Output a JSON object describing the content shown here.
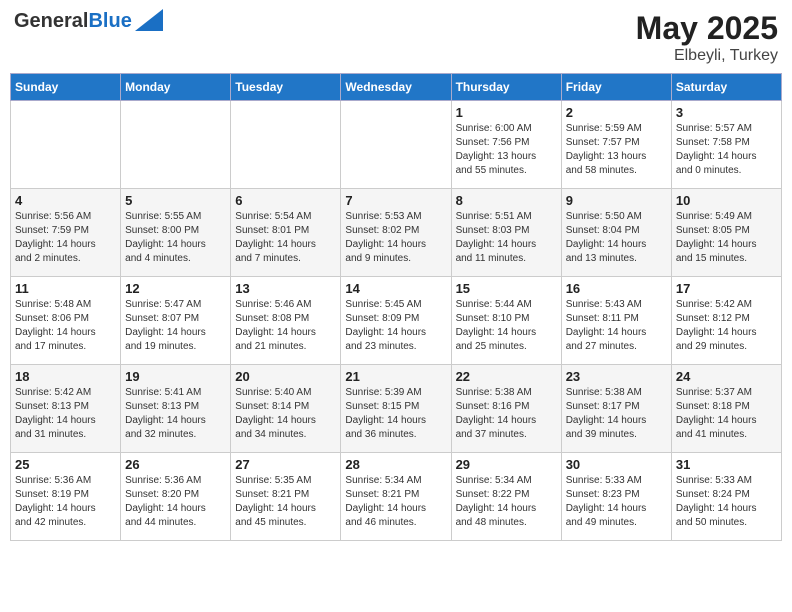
{
  "header": {
    "logo_general": "General",
    "logo_blue": "Blue",
    "title": "May 2025",
    "location": "Elbeyli, Turkey"
  },
  "weekdays": [
    "Sunday",
    "Monday",
    "Tuesday",
    "Wednesday",
    "Thursday",
    "Friday",
    "Saturday"
  ],
  "weeks": [
    [
      {
        "day": "",
        "info": ""
      },
      {
        "day": "",
        "info": ""
      },
      {
        "day": "",
        "info": ""
      },
      {
        "day": "",
        "info": ""
      },
      {
        "day": "1",
        "info": "Sunrise: 6:00 AM\nSunset: 7:56 PM\nDaylight: 13 hours\nand 55 minutes."
      },
      {
        "day": "2",
        "info": "Sunrise: 5:59 AM\nSunset: 7:57 PM\nDaylight: 13 hours\nand 58 minutes."
      },
      {
        "day": "3",
        "info": "Sunrise: 5:57 AM\nSunset: 7:58 PM\nDaylight: 14 hours\nand 0 minutes."
      }
    ],
    [
      {
        "day": "4",
        "info": "Sunrise: 5:56 AM\nSunset: 7:59 PM\nDaylight: 14 hours\nand 2 minutes."
      },
      {
        "day": "5",
        "info": "Sunrise: 5:55 AM\nSunset: 8:00 PM\nDaylight: 14 hours\nand 4 minutes."
      },
      {
        "day": "6",
        "info": "Sunrise: 5:54 AM\nSunset: 8:01 PM\nDaylight: 14 hours\nand 7 minutes."
      },
      {
        "day": "7",
        "info": "Sunrise: 5:53 AM\nSunset: 8:02 PM\nDaylight: 14 hours\nand 9 minutes."
      },
      {
        "day": "8",
        "info": "Sunrise: 5:51 AM\nSunset: 8:03 PM\nDaylight: 14 hours\nand 11 minutes."
      },
      {
        "day": "9",
        "info": "Sunrise: 5:50 AM\nSunset: 8:04 PM\nDaylight: 14 hours\nand 13 minutes."
      },
      {
        "day": "10",
        "info": "Sunrise: 5:49 AM\nSunset: 8:05 PM\nDaylight: 14 hours\nand 15 minutes."
      }
    ],
    [
      {
        "day": "11",
        "info": "Sunrise: 5:48 AM\nSunset: 8:06 PM\nDaylight: 14 hours\nand 17 minutes."
      },
      {
        "day": "12",
        "info": "Sunrise: 5:47 AM\nSunset: 8:07 PM\nDaylight: 14 hours\nand 19 minutes."
      },
      {
        "day": "13",
        "info": "Sunrise: 5:46 AM\nSunset: 8:08 PM\nDaylight: 14 hours\nand 21 minutes."
      },
      {
        "day": "14",
        "info": "Sunrise: 5:45 AM\nSunset: 8:09 PM\nDaylight: 14 hours\nand 23 minutes."
      },
      {
        "day": "15",
        "info": "Sunrise: 5:44 AM\nSunset: 8:10 PM\nDaylight: 14 hours\nand 25 minutes."
      },
      {
        "day": "16",
        "info": "Sunrise: 5:43 AM\nSunset: 8:11 PM\nDaylight: 14 hours\nand 27 minutes."
      },
      {
        "day": "17",
        "info": "Sunrise: 5:42 AM\nSunset: 8:12 PM\nDaylight: 14 hours\nand 29 minutes."
      }
    ],
    [
      {
        "day": "18",
        "info": "Sunrise: 5:42 AM\nSunset: 8:13 PM\nDaylight: 14 hours\nand 31 minutes."
      },
      {
        "day": "19",
        "info": "Sunrise: 5:41 AM\nSunset: 8:13 PM\nDaylight: 14 hours\nand 32 minutes."
      },
      {
        "day": "20",
        "info": "Sunrise: 5:40 AM\nSunset: 8:14 PM\nDaylight: 14 hours\nand 34 minutes."
      },
      {
        "day": "21",
        "info": "Sunrise: 5:39 AM\nSunset: 8:15 PM\nDaylight: 14 hours\nand 36 minutes."
      },
      {
        "day": "22",
        "info": "Sunrise: 5:38 AM\nSunset: 8:16 PM\nDaylight: 14 hours\nand 37 minutes."
      },
      {
        "day": "23",
        "info": "Sunrise: 5:38 AM\nSunset: 8:17 PM\nDaylight: 14 hours\nand 39 minutes."
      },
      {
        "day": "24",
        "info": "Sunrise: 5:37 AM\nSunset: 8:18 PM\nDaylight: 14 hours\nand 41 minutes."
      }
    ],
    [
      {
        "day": "25",
        "info": "Sunrise: 5:36 AM\nSunset: 8:19 PM\nDaylight: 14 hours\nand 42 minutes."
      },
      {
        "day": "26",
        "info": "Sunrise: 5:36 AM\nSunset: 8:20 PM\nDaylight: 14 hours\nand 44 minutes."
      },
      {
        "day": "27",
        "info": "Sunrise: 5:35 AM\nSunset: 8:21 PM\nDaylight: 14 hours\nand 45 minutes."
      },
      {
        "day": "28",
        "info": "Sunrise: 5:34 AM\nSunset: 8:21 PM\nDaylight: 14 hours\nand 46 minutes."
      },
      {
        "day": "29",
        "info": "Sunrise: 5:34 AM\nSunset: 8:22 PM\nDaylight: 14 hours\nand 48 minutes."
      },
      {
        "day": "30",
        "info": "Sunrise: 5:33 AM\nSunset: 8:23 PM\nDaylight: 14 hours\nand 49 minutes."
      },
      {
        "day": "31",
        "info": "Sunrise: 5:33 AM\nSunset: 8:24 PM\nDaylight: 14 hours\nand 50 minutes."
      }
    ]
  ]
}
